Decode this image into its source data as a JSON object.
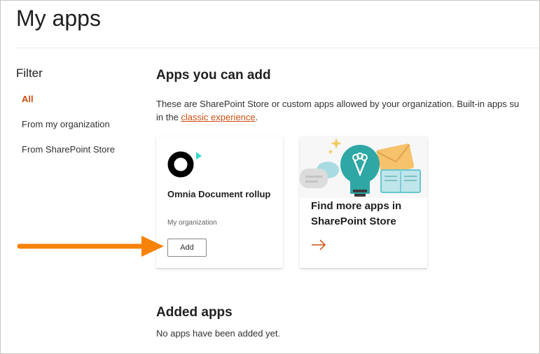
{
  "page": {
    "title": "My apps"
  },
  "filter": {
    "heading": "Filter",
    "items": [
      {
        "label": "All",
        "active": true
      },
      {
        "label": "From my organization",
        "active": false
      },
      {
        "label": "From SharePoint Store",
        "active": false
      }
    ]
  },
  "apps_section": {
    "heading": "Apps you can add",
    "description_prefix": "These are SharePoint Store or custom apps allowed by your organization. Built-in apps su",
    "description_line2_prefix": "in the ",
    "classic_link": "classic experience",
    "description_suffix": "."
  },
  "app_card": {
    "name": "Omnia Document rollup",
    "source": "My organization",
    "add_label": "Add"
  },
  "store_card": {
    "title": "Find more apps in SharePoint Store",
    "arrow_icon": "arrow-right-icon"
  },
  "added_section": {
    "heading": "Added apps",
    "empty_message": "No apps have been added yet."
  },
  "colors": {
    "accent": "#ca5010",
    "pointer_arrow": "#f7820a",
    "logo_teal": "#3dd6d0"
  }
}
